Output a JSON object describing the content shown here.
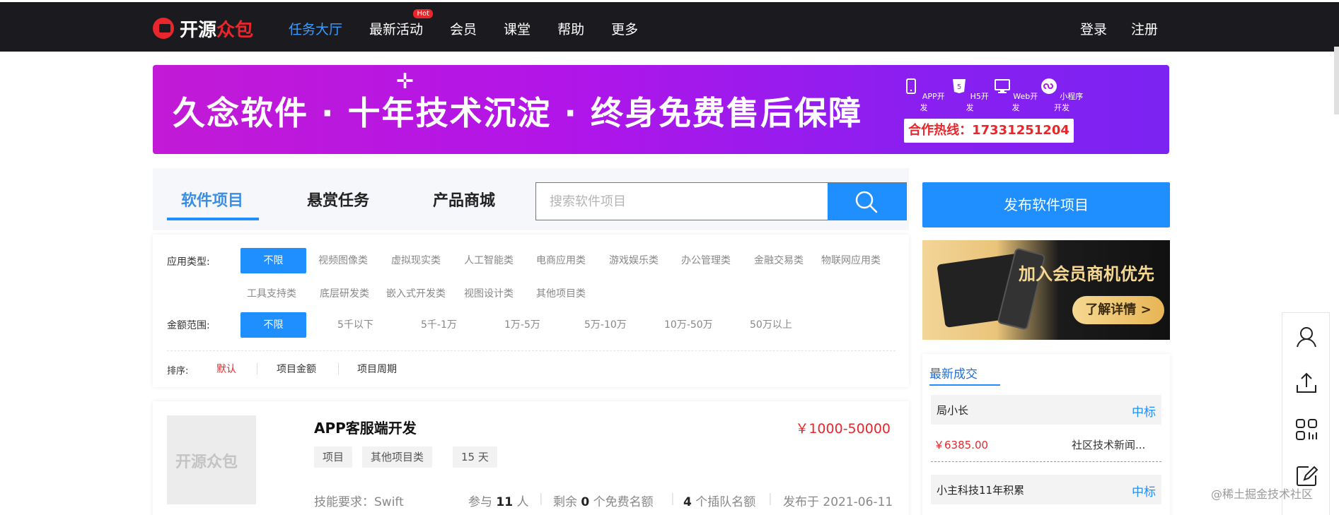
{
  "header": {
    "logo_a": "开源",
    "logo_b": "众包",
    "nav": [
      {
        "label": "任务大厅"
      },
      {
        "label": "最新活动",
        "badge": "Hot"
      },
      {
        "label": "会员"
      },
      {
        "label": "课堂"
      },
      {
        "label": "帮助"
      },
      {
        "label": "更多"
      }
    ],
    "login": "登录",
    "register": "注册"
  },
  "banner": {
    "slogan": "久念软件 · 十年技术沉淀 · 终身免费售后保障",
    "services": [
      "APP开发",
      "H5开发",
      "Web开发",
      "小程序开发"
    ],
    "hotline": "合作热线：17331251204"
  },
  "tabs": [
    "软件项目",
    "悬赏任务",
    "产品商城"
  ],
  "search": {
    "placeholder": "搜索软件项目"
  },
  "filters": {
    "app_type_label": "应用类型:",
    "app_types": [
      "不限",
      "视频图像类",
      "虚拟现实类",
      "人工智能类",
      "电商应用类",
      "游戏娱乐类",
      "办公管理类",
      "金融交易类",
      "物联网应用类",
      "工具支持类",
      "底层研发类",
      "嵌入式开发类",
      "视图设计类",
      "其他项目类"
    ],
    "amount_label": "金额范围:",
    "amounts": [
      "不限",
      "5千以下",
      "5千-1万",
      "1万-5万",
      "5万-10万",
      "10万-50万",
      "50万以上"
    ],
    "sort_label": "排序:",
    "sorts": [
      "默认",
      "项目金额",
      "项目周期"
    ]
  },
  "project": {
    "thumb_text": "开源众包",
    "title": "APP客服端开发",
    "price": "￥1000-50000",
    "tags": [
      "项目",
      "其他项目类",
      "15 天"
    ],
    "skill_label": "技能要求：",
    "skill": "Swift",
    "join_pre": "参与",
    "join_count": "11",
    "join_post": "人",
    "remain_pre": "剩余",
    "remain_count": "0",
    "remain_post": "个免费名额",
    "bid_count": "4",
    "bid_post": "个插队名额",
    "publish_pre": "发布于",
    "publish_date": "2021-06-11"
  },
  "sidebar": {
    "publish_button": "发布软件项目",
    "ad_title": "加入会员商机优先",
    "ad_button": "了解详情 >",
    "deals_title": "最新成交",
    "deals": [
      {
        "name": "局小长",
        "status": "中标",
        "amount": "￥6385.00",
        "desc": "社区技术新闻..."
      },
      {
        "name": "小主科技11年积累",
        "status": "中标"
      }
    ]
  },
  "float_icons": [
    "user-icon",
    "upload-icon",
    "qrcode-icon",
    "edit-icon"
  ],
  "watermark": "@稀土掘金技术社区",
  "colors": {
    "accent": "#1f8fff",
    "price_red": "#e8262b",
    "banner": "#b215e8",
    "topbar": "#1b1b1f"
  }
}
